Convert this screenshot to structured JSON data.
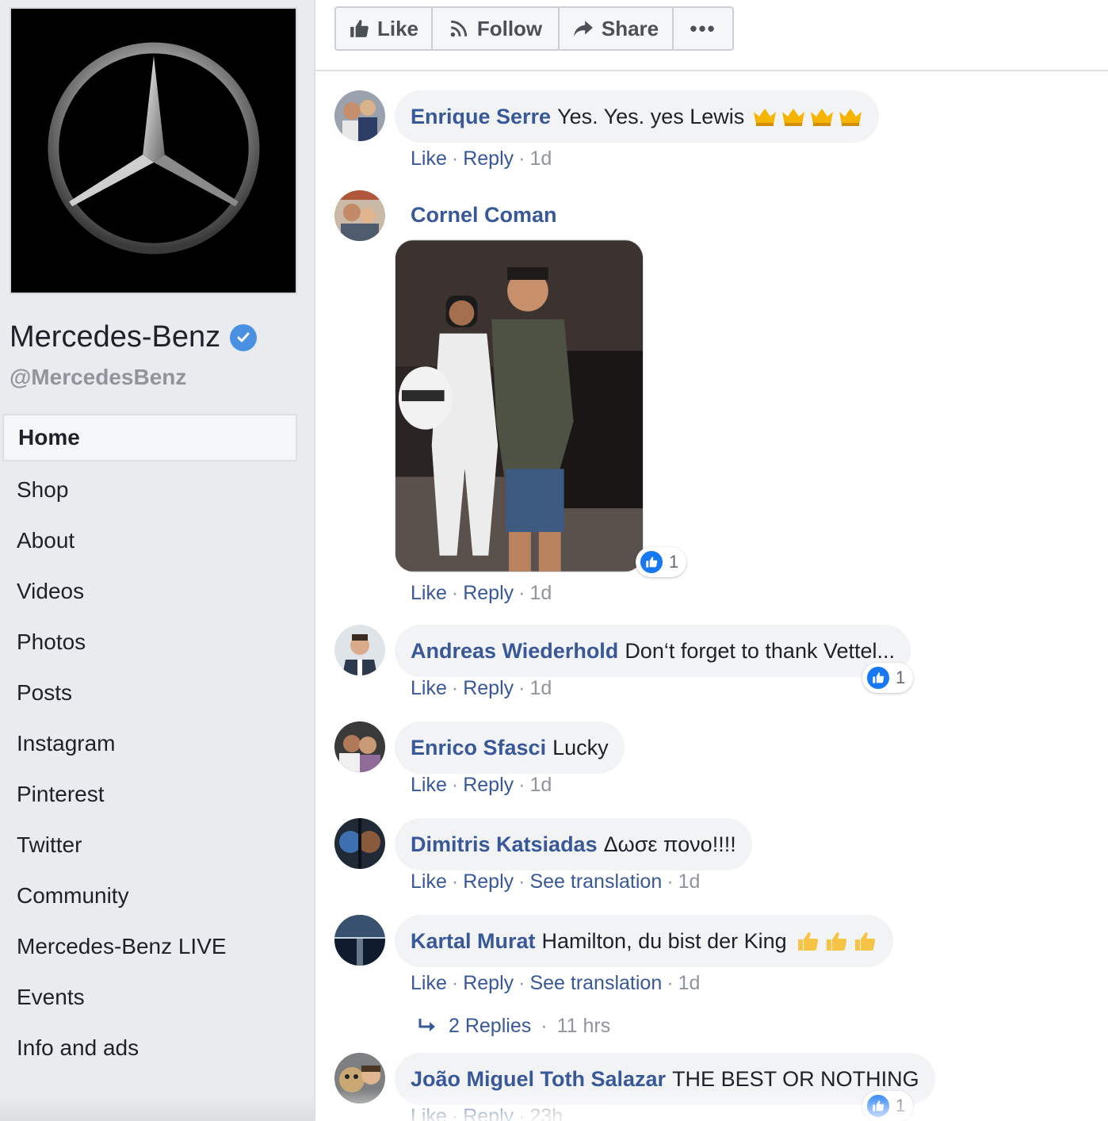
{
  "page": {
    "name": "Mercedes-Benz",
    "handle": "@MercedesBenz"
  },
  "nav": [
    "Home",
    "Shop",
    "About",
    "Videos",
    "Photos",
    "Posts",
    "Instagram",
    "Pinterest",
    "Twitter",
    "Community",
    "Mercedes-Benz LIVE",
    "Events",
    "Info and ads"
  ],
  "nav_active": "Home",
  "actions": {
    "like": "Like",
    "follow": "Follow",
    "share": "Share",
    "more": "•••"
  },
  "comment_actions": {
    "like": "Like",
    "reply": "Reply",
    "see_translation": "See translation"
  },
  "comments": [
    {
      "author": "Enrique Serre",
      "text": "Yes. Yes. yes Lewis",
      "emoji": "crown-emoji x4",
      "time": "1d"
    },
    {
      "author": "Cornel Coman",
      "text": "",
      "has_photo": true,
      "reactions": "1",
      "time": "1d"
    },
    {
      "author": "Andreas Wiederhold",
      "text": "Don‘t forget to thank Vettel...",
      "reactions": "1",
      "time": "1d"
    },
    {
      "author": "Enrico Sfasci",
      "text": "Lucky",
      "time": "1d"
    },
    {
      "author": "Dimitris Katsiadas",
      "text": "Δωσε πονο!!!!",
      "time": "1d"
    },
    {
      "author": "Kartal Murat",
      "text": "Hamilton, du bist der King",
      "emoji": "thumbs-up-emoji x3",
      "time": "1d",
      "replies": "2 Replies",
      "replies_time": "11 hrs"
    },
    {
      "author": "João Miguel Toth Salazar",
      "text": "THE BEST OR NOTHING",
      "reactions": "1",
      "time": "23h"
    }
  ],
  "colors": {
    "link": "#385898",
    "muted": "#90949c",
    "bubble": "#f2f3f5",
    "like_blue": "#1877f2",
    "sidebar_bg": "#e9ebee"
  }
}
